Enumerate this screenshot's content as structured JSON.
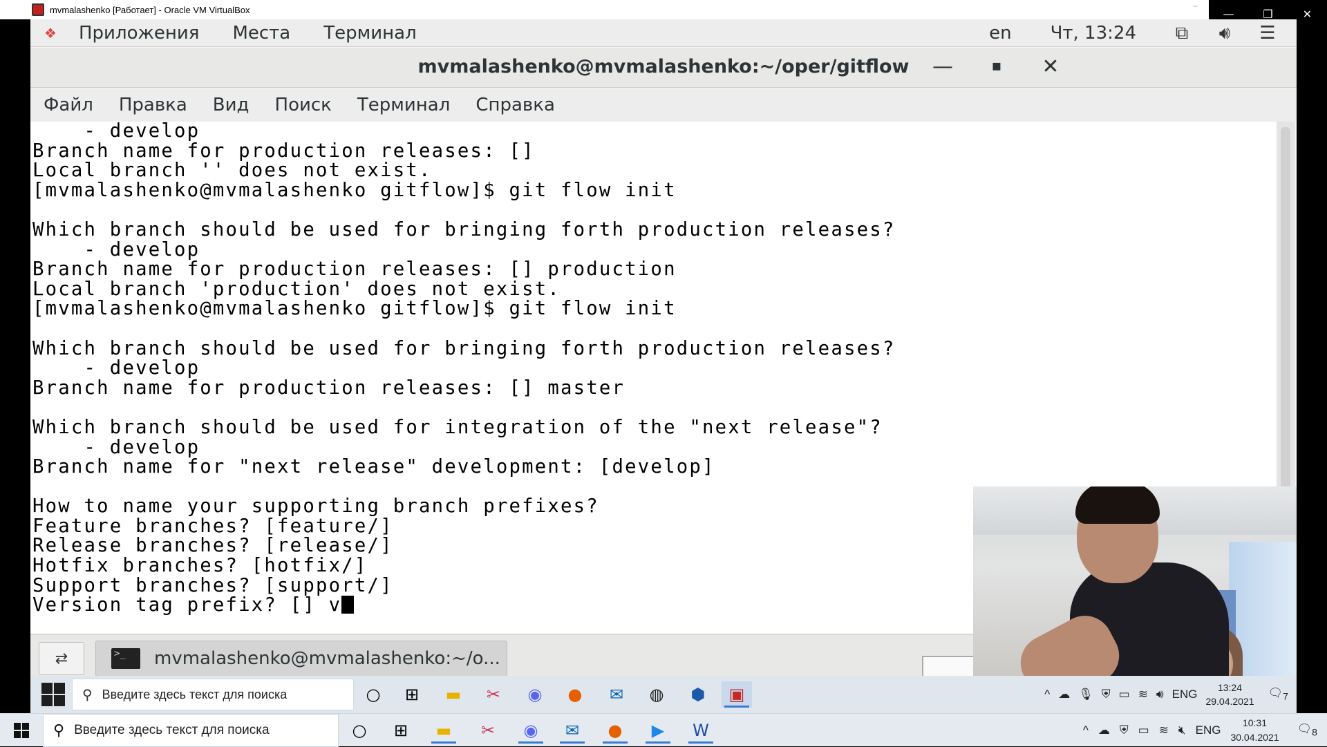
{
  "vbox": {
    "title": "mvmalashenko [Работает] - Oracle VM VirtualBox",
    "min": "—",
    "max": "❐",
    "close": "✕"
  },
  "gnome_top": {
    "apps": "Приложения",
    "places": "Места",
    "terminal": "Терминал",
    "lang": "en",
    "clock": "Чт, 13:24"
  },
  "terminal": {
    "title": "mvmalashenko@mvmalashenko:~/oper/gitflow",
    "min": "—",
    "max": "▪",
    "close": "✕",
    "menu": [
      "Файл",
      "Правка",
      "Вид",
      "Поиск",
      "Терминал",
      "Справка"
    ],
    "lines": [
      "    - develop",
      "Branch name for production releases: []",
      "Local branch '' does not exist.",
      "[mvmalashenko@mvmalashenko gitflow]$ git flow init",
      "",
      "Which branch should be used for bringing forth production releases?",
      "    - develop",
      "Branch name for production releases: [] production",
      "Local branch 'production' does not exist.",
      "[mvmalashenko@mvmalashenko gitflow]$ git flow init",
      "",
      "Which branch should be used for bringing forth production releases?",
      "    - develop",
      "Branch name for production releases: [] master",
      "",
      "Which branch should be used for integration of the \"next release\"?",
      "    - develop",
      "Branch name for \"next release\" development: [develop]",
      "",
      "How to name your supporting branch prefixes?",
      "Feature branches? [feature/]",
      "Release branches? [release/]",
      "Hotfix branches? [hotfix/]",
      "Support branches? [support/]",
      "Version tag prefix? [] v"
    ]
  },
  "gnome_bottom": {
    "task_label": "mvmalashenko@mvmalashenko:~/o..."
  },
  "inner_taskbar": {
    "search_placeholder": "Введите здесь текст для поиска",
    "lang": "ENG",
    "time": "13:24",
    "date": "29.04.2021",
    "notif_count": "7"
  },
  "host_taskbar": {
    "search_placeholder": "Введите здесь текст для поиска",
    "lang": "ENG",
    "time": "10:31",
    "date": "30.04.2021",
    "notif_count": "8"
  }
}
